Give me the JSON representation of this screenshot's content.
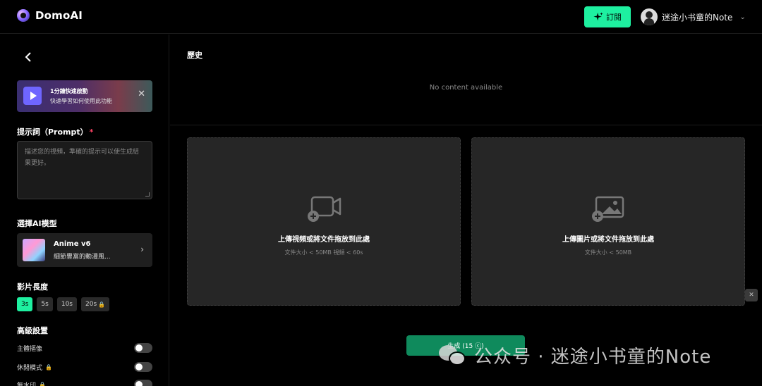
{
  "app": {
    "name": "DomoAI"
  },
  "header": {
    "subscribe_label": "訂閱",
    "user_name": "迷途小书童的Note",
    "icons": {
      "subscribe": "sparkle-icon",
      "dropdown": "chevron-down-icon"
    }
  },
  "sidebar": {
    "banner": {
      "title": "1分鐘快速啟動",
      "subtitle": "快速學習如何使用此功能"
    },
    "prompt": {
      "label": "提示詞（Prompt）",
      "required_mark": "*",
      "placeholder": "描述您的視頻，準確的提示可以使生成結果更好。"
    },
    "model": {
      "section_label": "選擇AI模型",
      "name": "Anime v6",
      "description": "細節豐富的動漫風..."
    },
    "duration": {
      "section_label": "影片長度",
      "options": [
        "3s",
        "5s",
        "10s",
        "20s"
      ],
      "selected": "3s"
    },
    "advanced": {
      "section_label": "高級設置",
      "toggles": [
        {
          "label": "主體摳像",
          "locked": false,
          "on": false
        },
        {
          "label": "休閒模式",
          "locked": true,
          "on": false
        },
        {
          "label": "無水印",
          "locked": true,
          "on": false
        }
      ]
    }
  },
  "main": {
    "history": {
      "title": "歷史",
      "empty_text": "No content available"
    },
    "upload_video": {
      "title": "上傳視頻或將文件拖放到此處",
      "subtitle": "文件大小 < 50MB   視頻 < 60s"
    },
    "upload_image": {
      "title": "上傳圖片或將文件拖放到此處",
      "subtitle": "文件大小 < 50MB"
    },
    "generate_label": "生成 (15 ⓒ)"
  },
  "watermark": {
    "text": "公众号 · 迷途小书童的Note"
  },
  "colors": {
    "accent": "#1ef0a0",
    "background": "#000000",
    "panel": "#262626"
  }
}
